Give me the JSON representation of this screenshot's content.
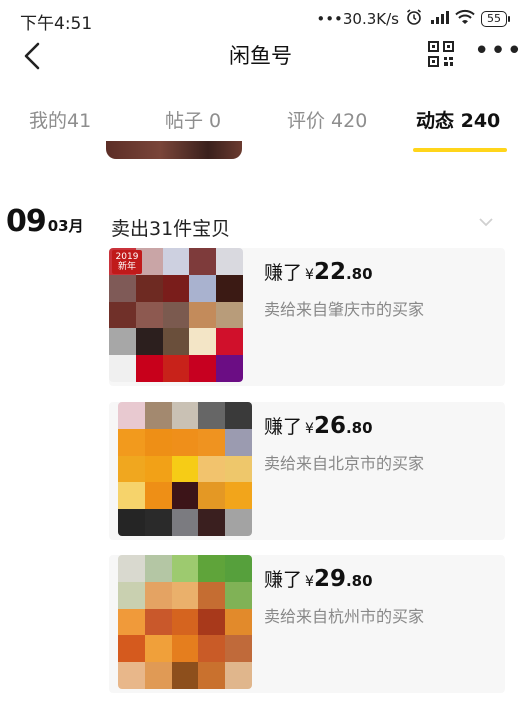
{
  "status_bar": {
    "time": "下午4:51",
    "network_speed": "•••30.3K/s",
    "alarm_icon": "alarm-icon",
    "signal_icon": "signal-icon",
    "wifi_icon": "wifi-icon",
    "battery": "55"
  },
  "nav": {
    "title": "闲鱼号",
    "back_icon": "chevron-left-icon",
    "qr_icon": "qr-code-icon",
    "more_icon": "more-icon",
    "more_glyph": "•••"
  },
  "tabs": [
    {
      "label": "我的41",
      "active": false
    },
    {
      "label": "帖子 0",
      "active": false
    },
    {
      "label": "评价 420",
      "active": false
    },
    {
      "label": "动态 240",
      "active": true
    }
  ],
  "colors": {
    "accent": "#ffd51a",
    "card_bg": "#f7f7f7",
    "muted_text": "#888888"
  },
  "feed": {
    "date_day": "09",
    "date_month": "03月",
    "summary": "卖出31件宝贝",
    "collapse_icon": "chevron-down-icon",
    "items": [
      {
        "earned_label": "赚了",
        "currency": "¥",
        "amount_int": "22",
        "amount_dec": ".80",
        "buyer_text": "卖给来自肇庆市的买家",
        "badge_text": "2019 新年",
        "thumb_colors": [
          "#c9333b",
          "#c9a5a6",
          "#cdd0e0",
          "#7e3b3b",
          "#d9d9df",
          "#7f5a57",
          "#6e2a22",
          "#7a1d1b",
          "#a9b2cf",
          "#3b1a14",
          "#703029",
          "#8d5950",
          "#7b5a4f",
          "#c38b5b",
          "#b89c7a",
          "#a7a7a7",
          "#2c1f1e",
          "#6a4f3b",
          "#f3e5c6",
          "#d0102b",
          "#f0f0f0",
          "#c8001b",
          "#c8221a",
          "#c70020",
          "#6b0d84"
        ]
      },
      {
        "earned_label": "赚了",
        "currency": "¥",
        "amount_int": "26",
        "amount_dec": ".80",
        "buyer_text": "卖给来自北京市的买家",
        "thumb_colors": [
          "#e8c9d0",
          "#a3896f",
          "#c9c1b4",
          "#666666",
          "#3a3a3a",
          "#f29a1d",
          "#ee8f16",
          "#ef8f1a",
          "#ef9320",
          "#9b9bb0",
          "#f0a71f",
          "#f2a117",
          "#f6cc16",
          "#f2c36d",
          "#eec76b",
          "#f6d36b",
          "#ee8f16",
          "#3c1418",
          "#e49824",
          "#f2a51b",
          "#252525",
          "#2a2a2a",
          "#7b7b80",
          "#3a1f1f",
          "#a3a3a3"
        ]
      },
      {
        "earned_label": "赚了",
        "currency": "¥",
        "amount_int": "29",
        "amount_dec": ".80",
        "buyer_text": "卖给来自杭州市的买家",
        "thumb_colors": [
          "#d9d9cf",
          "#b4c6a4",
          "#9dca6f",
          "#5fa43a",
          "#56a03c",
          "#c9d0b0",
          "#e4a363",
          "#eab06b",
          "#c56d32",
          "#80b256",
          "#f09a3a",
          "#c9582b",
          "#d5641f",
          "#a8391b",
          "#e28a2b",
          "#d55a1e",
          "#f0a03a",
          "#e57e1e",
          "#c95b27",
          "#c06a3a",
          "#e8b78a",
          "#e09a55",
          "#8d4f1c",
          "#c9712e",
          "#e0b68c"
        ]
      }
    ]
  }
}
